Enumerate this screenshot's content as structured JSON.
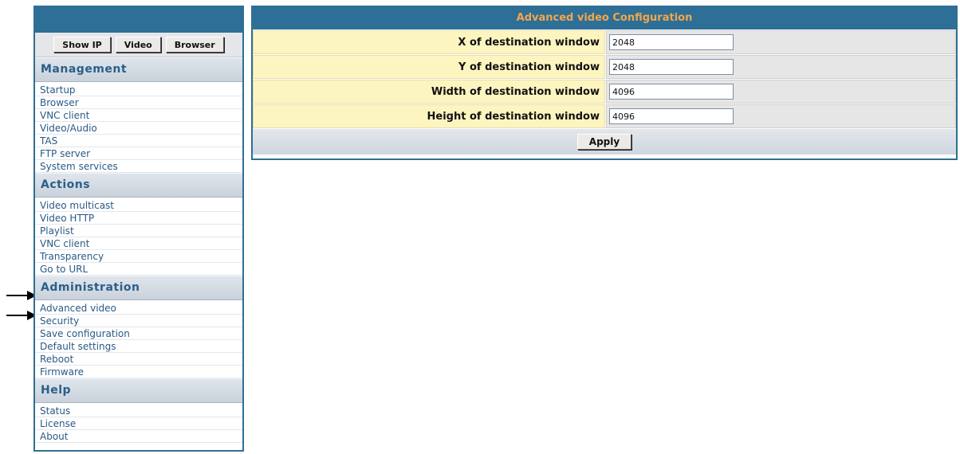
{
  "sidebar": {
    "buttons": [
      "Show IP",
      "Video",
      "Browser"
    ],
    "sections": [
      {
        "title": "Management",
        "items": [
          "Startup",
          "Browser",
          "VNC client",
          "Video/Audio",
          "TAS",
          "FTP server",
          "System services"
        ]
      },
      {
        "title": "Actions",
        "items": [
          "Video multicast",
          "Video HTTP",
          "Playlist",
          "VNC client",
          "Transparency",
          "Go to URL"
        ]
      },
      {
        "title": "Administration",
        "items": [
          "Advanced video",
          "Security",
          "Save configuration",
          "Default settings",
          "Reboot",
          "Firmware"
        ]
      },
      {
        "title": "Help",
        "items": [
          "Status",
          "License",
          "About"
        ]
      }
    ]
  },
  "main": {
    "title": "Advanced video Configuration",
    "fields": [
      {
        "label": "X of destination window",
        "value": "2048"
      },
      {
        "label": "Y of destination window",
        "value": "2048"
      },
      {
        "label": "Width of destination window",
        "value": "4096"
      },
      {
        "label": "Height of destination window",
        "value": "4096"
      }
    ],
    "apply_label": "Apply"
  },
  "colors": {
    "header_blue": "#2d6f96",
    "title_orange": "#f3a64b",
    "label_bg": "#fdf5c0",
    "menu_text": "#2a5a86"
  }
}
